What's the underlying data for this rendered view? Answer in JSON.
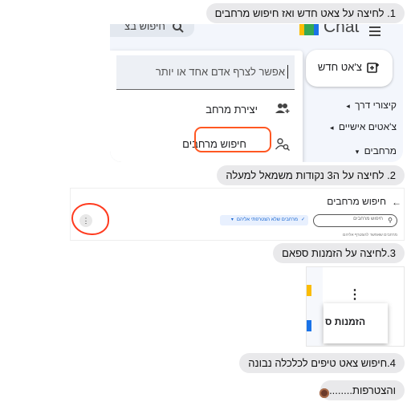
{
  "steps": {
    "step1": "1. לחיצה על צאט חדש ואז חיפוש מרחבים",
    "step2": "2. לחיצה על ה3 נקודות משמאל למעלה",
    "step3": "3.לחיצה על הזמנות ספאם",
    "step4": "4.חיפוש צאט טיפים לכלכלה נבונה",
    "step5": "והצטרפות........"
  },
  "screenshot1": {
    "app_name": "Chat",
    "search_placeholder": "חיפוש בצ",
    "new_chat_button": "צ'אט חדש",
    "people_input_placeholder": "אפשר לצרף אדם אחד או יותר",
    "create_space": "יצירת מרחב",
    "browse_spaces": "חיפוש מרחבים",
    "nav_shortcuts": "קיצורי דרך",
    "nav_direct_messages": "צ'אטים אישיים",
    "nav_spaces": "מרחבים",
    "highlight_color": "#ff5722"
  },
  "screenshot2": {
    "page_title": "חיפוש מרחבים",
    "search_placeholder": "חיפוש מרחבים",
    "filter_chip": "מרחבים שלא הצטרפתי אליהם",
    "subtext": "מרחבים שאפשר להצטרף אליהם",
    "highlight_color": "#ff5722"
  },
  "screenshot3": {
    "menu_item": "הזמנות ס"
  },
  "colors": {
    "bubble": "#e9e9eb",
    "accent": "#1a73e8",
    "panel": "#f3f6fc"
  }
}
